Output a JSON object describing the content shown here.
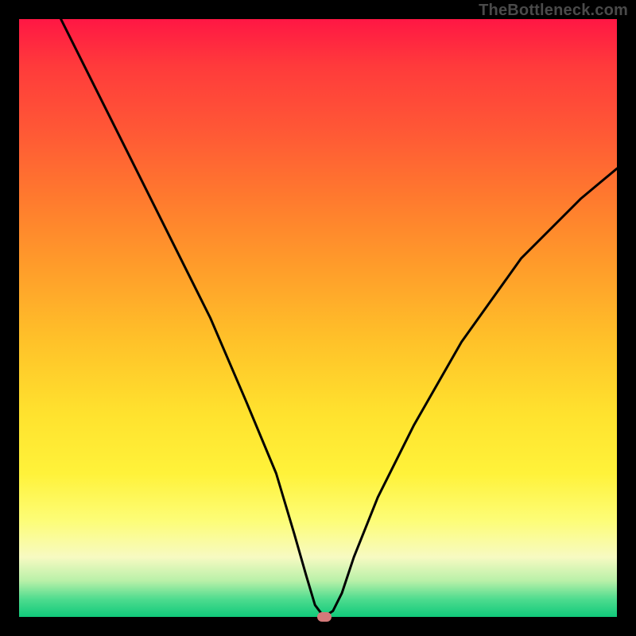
{
  "watermark": "TheBottleneck.com",
  "chart_data": {
    "type": "line",
    "title": "",
    "xlabel": "",
    "ylabel": "",
    "xlim": [
      0,
      100
    ],
    "ylim": [
      0,
      100
    ],
    "grid": false,
    "legend": false,
    "series": [
      {
        "name": "curve",
        "x": [
          7,
          12,
          18,
          25,
          32,
          38,
          43,
          46,
          48,
          49.5,
          51,
          52.5,
          54,
          56,
          60,
          66,
          74,
          84,
          94,
          100
        ],
        "y": [
          100,
          90,
          78,
          64,
          50,
          36,
          24,
          14,
          7,
          2,
          0,
          1,
          4,
          10,
          20,
          32,
          46,
          60,
          70,
          75
        ]
      }
    ],
    "marker": {
      "x": 51,
      "y": 0,
      "color": "#d47a7a"
    },
    "gradient_stops": [
      {
        "pos": 0,
        "color": "#ff1744"
      },
      {
        "pos": 50,
        "color": "#ffd23a"
      },
      {
        "pos": 90,
        "color": "#fdfd78"
      },
      {
        "pos": 100,
        "color": "#10c97a"
      }
    ]
  }
}
